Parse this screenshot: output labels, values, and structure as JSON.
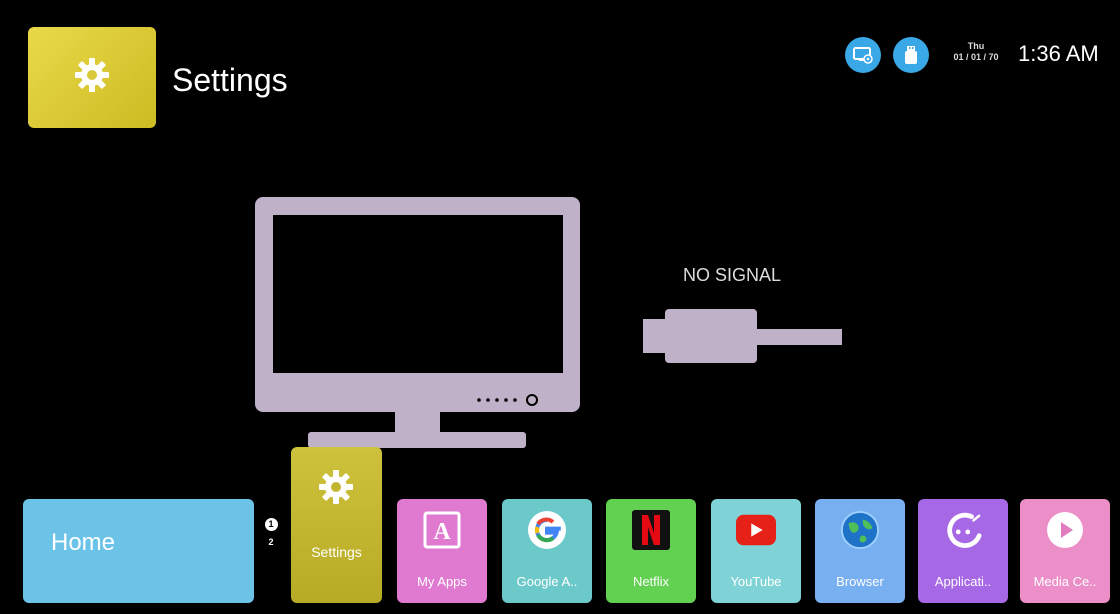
{
  "header": {
    "title": "Settings",
    "tile_icon": "gear-icon",
    "status_icons": [
      "screen-share-icon",
      "usb-drive-icon"
    ],
    "day": "Thu",
    "date": "01 / 01 / 70",
    "time": "1:36 AM"
  },
  "center": {
    "message": "NO SIGNAL",
    "illustration": "tv-disconnected-cable-icon"
  },
  "bottom_bar": {
    "home_label": "Home",
    "pages": [
      "1",
      "2"
    ],
    "settings_label": "Settings",
    "apps": [
      {
        "label": "My Apps",
        "icon": "my-apps-icon",
        "color": "#e07ad0"
      },
      {
        "label": "Google A..",
        "icon": "google-icon",
        "color": "#6cc9c9"
      },
      {
        "label": "Netflix",
        "icon": "netflix-icon",
        "color": "#62d050"
      },
      {
        "label": "YouTube",
        "icon": "youtube-icon",
        "color": "#7fd3d6"
      },
      {
        "label": "Browser",
        "icon": "globe-icon",
        "color": "#78aff0"
      },
      {
        "label": "Applicati..",
        "icon": "app-store-icon",
        "color": "#a768e6"
      },
      {
        "label": "Media Ce..",
        "icon": "play-icon",
        "color": "#ec8ec7"
      }
    ]
  },
  "colors": {
    "settings_yellow": "#d8c93a",
    "home_blue": "#6cc3e8",
    "status_blue": "#3aa7e6",
    "tv_lavender": "#bfb1c8"
  }
}
